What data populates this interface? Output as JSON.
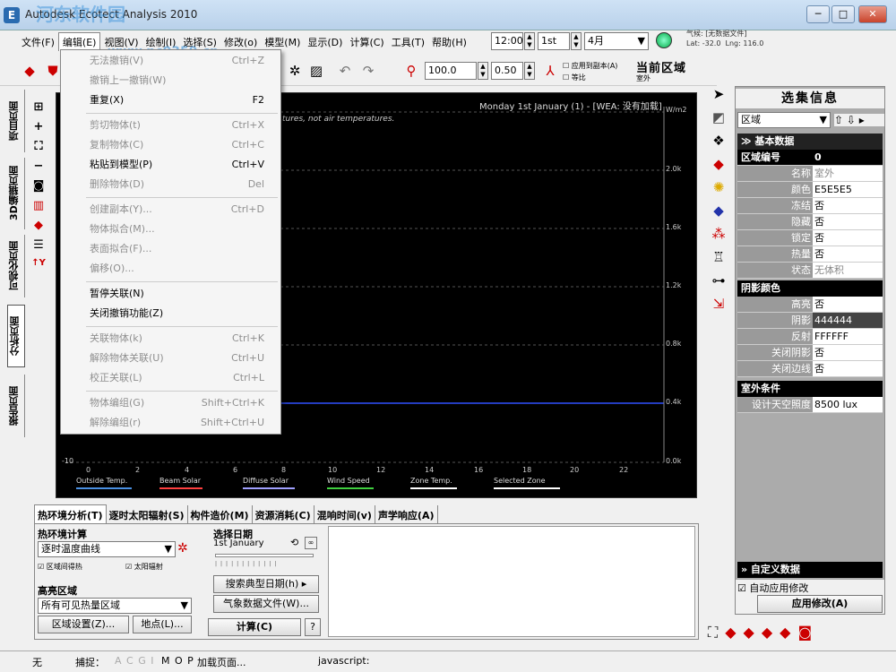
{
  "window": {
    "title": "Autodesk Ecotect Analysis 2010",
    "min": "─",
    "max": "□",
    "close": "✕"
  },
  "watermark": "www.pc0359.cn",
  "menubar": [
    "文件(F)",
    "编辑(E)",
    "视图(V)",
    "绘制(I)",
    "选择(S)",
    "修改(o)",
    "模型(M)",
    "显示(D)",
    "计算(C)",
    "工具(T)",
    "帮助(H)"
  ],
  "toolbar1": {
    "time": "12:00",
    "day": "1st",
    "month": "4月"
  },
  "weather": {
    "line1": "气候: [无数据文件]",
    "lat": "Lat: -32.0",
    "lng": "Lng: 116.0"
  },
  "toolbar2": {
    "value1": "100.0",
    "value2": "0.50",
    "opt1": "应用到副本(A)",
    "opt2": "等比",
    "zone_title": "当前区域",
    "zone_sub": "室外"
  },
  "left_tabs": [
    "项目页面",
    "3D编辑页面",
    "可视化页面",
    "分析页面",
    "报告页面"
  ],
  "left_tools": [
    "⊞",
    "+",
    "⛶",
    "−",
    "◙",
    "▥",
    "◆",
    "☰",
    "↑Y"
  ],
  "chart": {
    "header": "Monday 1st January (1) - [WEA: 没有加载]",
    "note": "tures, not air temperatures.",
    "unit": "W/m2",
    "right_ticks": [
      "2.0k",
      "1.6k",
      "1.2k",
      "0.8k",
      "0.4k",
      "0.0k"
    ],
    "left_tick": "-10",
    "x_ticks": [
      "0",
      "2",
      "4",
      "6",
      "8",
      "10",
      "12",
      "14",
      "16",
      "18",
      "20",
      "22"
    ],
    "legend": [
      {
        "label": "Outside Temp.",
        "color": "#4a90e2"
      },
      {
        "label": "Beam Solar",
        "color": "#ff4040"
      },
      {
        "label": "Diffuse Solar",
        "color": "#a0a0ff"
      },
      {
        "label": "Wind Speed",
        "color": "#40d040"
      },
      {
        "label": "Zone Temp.",
        "color": "#ffffff"
      },
      {
        "label": "Selected Zone",
        "color": "#ffffff"
      }
    ]
  },
  "edit_menu": [
    {
      "label": "无法撤销(V)",
      "shortcut": "Ctrl+Z",
      "disabled": true
    },
    {
      "label": "撤销上一撤销(W)",
      "shortcut": "",
      "disabled": true
    },
    {
      "label": "重复(X)",
      "shortcut": "F2",
      "disabled": false
    },
    {
      "label": "剪切物体(t)",
      "shortcut": "Ctrl+X",
      "disabled": true
    },
    {
      "label": "复制物体(C)",
      "shortcut": "Ctrl+C",
      "disabled": true
    },
    {
      "label": "粘贴到模型(P)",
      "shortcut": "Ctrl+V",
      "disabled": false
    },
    {
      "label": "删除物体(D)",
      "shortcut": "Del",
      "disabled": true
    },
    {
      "label": "创建副本(Y)...",
      "shortcut": "Ctrl+D",
      "disabled": true
    },
    {
      "label": "物体拟合(M)...",
      "shortcut": "",
      "disabled": true
    },
    {
      "label": "表面拟合(F)...",
      "shortcut": "",
      "disabled": true
    },
    {
      "label": "偏移(O)...",
      "shortcut": "",
      "disabled": true
    },
    {
      "label": "暂停关联(N)",
      "shortcut": "",
      "disabled": false
    },
    {
      "label": "关闭撤销功能(Z)",
      "shortcut": "",
      "disabled": false
    },
    {
      "label": "关联物体(k)",
      "shortcut": "Ctrl+K",
      "disabled": true
    },
    {
      "label": "解除物体关联(U)",
      "shortcut": "Ctrl+U",
      "disabled": true
    },
    {
      "label": "校正关联(L)",
      "shortcut": "Ctrl+L",
      "disabled": true
    },
    {
      "label": "物体编组(G)",
      "shortcut": "Shift+Ctrl+K",
      "disabled": true
    },
    {
      "label": "解除编组(r)",
      "shortcut": "Shift+Ctrl+U",
      "disabled": true
    }
  ],
  "selection_panel": {
    "title": "选集信息",
    "dropdown": "区域",
    "nav": "⇧ ⇩ ▸",
    "basic_section": "≫ 基本数据",
    "zone_label": "区域编号",
    "zone_value": "0",
    "props": [
      {
        "k": "名称",
        "v": "室外"
      },
      {
        "k": "颜色",
        "v": "E5E5E5"
      },
      {
        "k": "冻结",
        "v": "否"
      },
      {
        "k": "隐藏",
        "v": "否"
      },
      {
        "k": "锁定",
        "v": "否"
      },
      {
        "k": "热量",
        "v": "否"
      },
      {
        "k": "状态",
        "v": "无体积"
      }
    ],
    "shade_section": "阴影颜色",
    "shade_props": [
      {
        "k": "高亮",
        "v": "否"
      },
      {
        "k": "阴影",
        "v": "444444"
      },
      {
        "k": "反射",
        "v": "FFFFFF"
      },
      {
        "k": "关闭阴影",
        "v": "否"
      },
      {
        "k": "关闭边线",
        "v": "否"
      }
    ],
    "outdoor_section": "室外条件",
    "outdoor_props": [
      {
        "k": "设计天空照度",
        "v": "8500 lux"
      }
    ],
    "custom_section": "» 自定义数据",
    "auto_apply": "自动应用修改",
    "apply_btn": "应用修改(A)"
  },
  "bottom_tabs": [
    "热环境分析(T)",
    "逐时太阳辐射(S)",
    "构件造价(M)",
    "资源消耗(C)",
    "混响时间(v)",
    "声学响应(A)"
  ],
  "bottom": {
    "thermal_group": "热环境计算",
    "thermal_select": "逐时温度曲线",
    "cb1": "区域间得热",
    "cb2": "太阳辐射",
    "highlight_group": "高亮区域",
    "highlight_select": "所有可见热量区域",
    "zone_settings": "区域设置(Z)...",
    "site": "地点(L)...",
    "date_group": "选择日期",
    "date_value": "1st January",
    "search_btn": "搜索典型日期(h) ▸",
    "weather_btn": "气象数据文件(W)...",
    "calc_btn": "计算(C)",
    "help_btn": "?"
  },
  "status": {
    "s1": "无",
    "s2": "捕捉：",
    "s3": "A C G I",
    "s4": "M O P",
    "s5": "加载页面...",
    "s6": "javascript:"
  }
}
